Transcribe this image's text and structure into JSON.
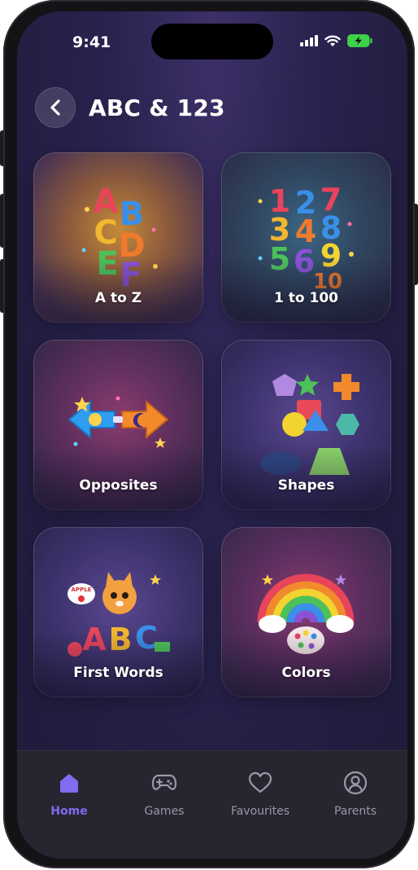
{
  "status_bar": {
    "time": "9:41"
  },
  "header": {
    "title": "ABC & 123"
  },
  "cards": [
    {
      "label": "A to Z"
    },
    {
      "label": "1 to 100"
    },
    {
      "label": "Opposites"
    },
    {
      "label": "Shapes"
    },
    {
      "label": "First Words"
    },
    {
      "label": "Colors"
    }
  ],
  "card_art": {
    "letters": [
      "A",
      "B",
      "C",
      "D",
      "E",
      "F"
    ],
    "numbers": [
      "1",
      "2",
      "7",
      "3",
      "4",
      "8",
      "5",
      "6",
      "9",
      "10"
    ],
    "first_words_bubble": "APPLE",
    "first_words_letters": [
      "A",
      "B",
      "C"
    ]
  },
  "tabs": [
    {
      "label": "Home",
      "icon": "home-icon",
      "active": true
    },
    {
      "label": "Games",
      "icon": "gamepad-icon",
      "active": false
    },
    {
      "label": "Favourites",
      "icon": "heart-icon",
      "active": false
    },
    {
      "label": "Parents",
      "icon": "user-circle-icon",
      "active": false
    }
  ],
  "colors": {
    "accent": "#7f6cf0",
    "tab_inactive": "#9a98a6",
    "tabbar_bg": "#27252f"
  }
}
